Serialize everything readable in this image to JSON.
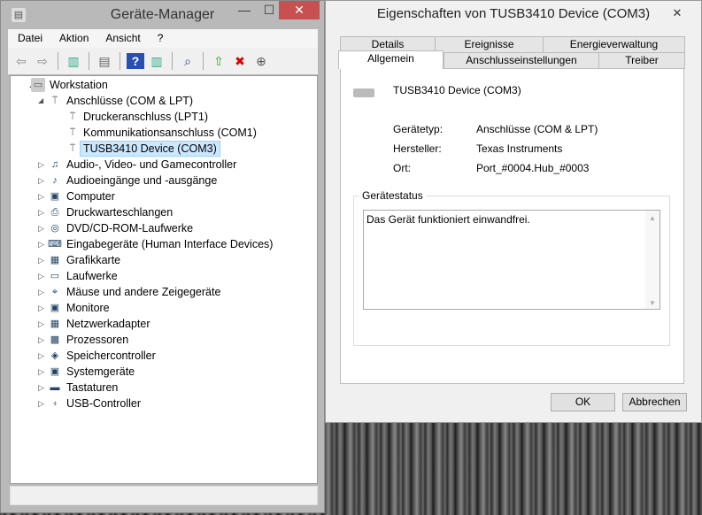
{
  "device_manager": {
    "title": "Geräte-Manager",
    "menu": [
      "Datei",
      "Aktion",
      "Ansicht",
      "?"
    ],
    "tree": {
      "root": "Workstation",
      "expanded_category": "Anschlüsse (COM & LPT)",
      "children": [
        "Druckeranschluss (LPT1)",
        "Kommunikationsanschluss (COM1)",
        "TUSB3410 Device (COM3)"
      ],
      "selected": "TUSB3410 Device (COM3)",
      "categories": [
        "Audio-, Video- und Gamecontroller",
        "Audioeingänge und -ausgänge",
        "Computer",
        "Druckwarteschlangen",
        "DVD/CD-ROM-Laufwerke",
        "Eingabegeräte (Human Interface Devices)",
        "Grafikkarte",
        "Laufwerke",
        "Mäuse und andere Zeigegeräte",
        "Monitore",
        "Netzwerkadapter",
        "Prozessoren",
        "Speichercontroller",
        "Systemgeräte",
        "Tastaturen",
        "USB-Controller"
      ]
    }
  },
  "properties": {
    "title": "Eigenschaften von TUSB3410 Device (COM3)",
    "tabs_back": [
      "Details",
      "Ereignisse",
      "Energieverwaltung"
    ],
    "tabs_front": [
      "Allgemein",
      "Anschlusseinstellungen",
      "Treiber"
    ],
    "device_name": "TUSB3410 Device (COM3)",
    "fields": [
      {
        "label": "Gerätetyp:",
        "value": "Anschlüsse (COM & LPT)"
      },
      {
        "label": "Hersteller:",
        "value": "Texas Instruments"
      },
      {
        "label": "Ort:",
        "value": "Port_#0004.Hub_#0003"
      }
    ],
    "status_title": "Gerätestatus",
    "status_text": "Das Gerät funktioniert einwandfrei.",
    "ok": "OK",
    "cancel": "Abbrechen"
  },
  "colors": {
    "close": "#c75050",
    "selection": "#cce8ff"
  }
}
